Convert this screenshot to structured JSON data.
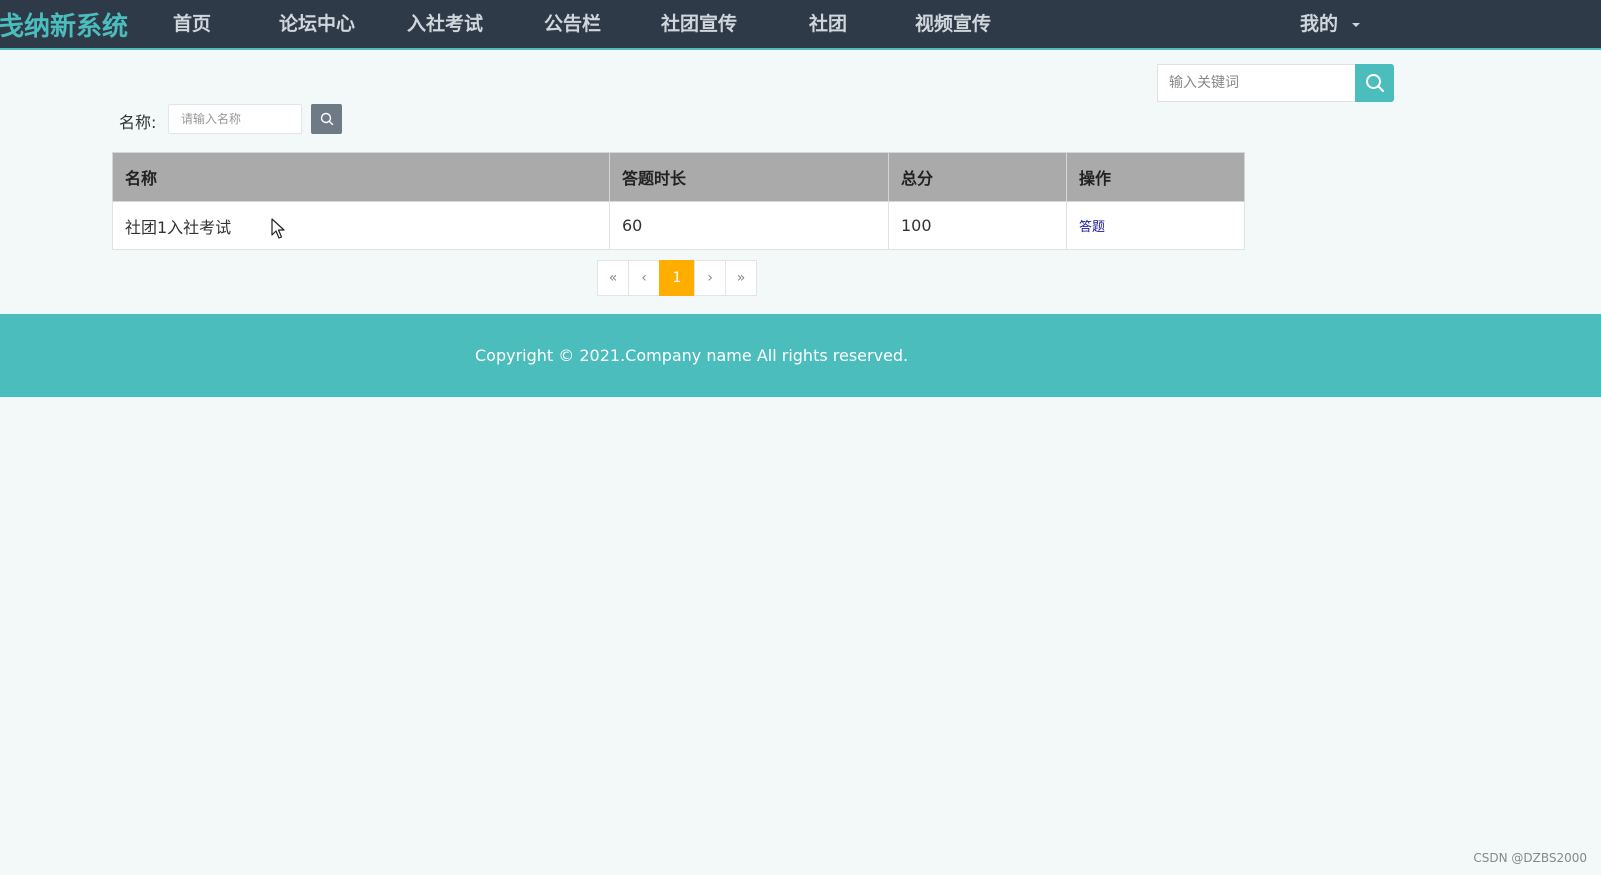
{
  "navbar": {
    "brand": "戋纳新系统",
    "items": [
      "首页",
      "论坛中心",
      "入社考试",
      "公告栏",
      "社团宣传",
      "社团",
      "视频宣传"
    ],
    "me": "我的"
  },
  "search": {
    "placeholder": "输入关键词"
  },
  "filter": {
    "label": "名称:",
    "placeholder": "请输入名称"
  },
  "table": {
    "headers": [
      "名称",
      "答题时长",
      "总分",
      "操作"
    ],
    "rows": [
      {
        "name": "社团1入社考试",
        "duration": "60",
        "total": "100",
        "action": "答题"
      }
    ]
  },
  "pagination": {
    "first": "«",
    "prev": "‹",
    "current": "1",
    "next": "›",
    "last": "»"
  },
  "footer": {
    "text": "Copyright © 2021.Company name All rights reserved."
  },
  "watermark": "CSDN @DZBS2000",
  "colors": {
    "accent": "#4bbdbd",
    "navbar": "#2f3a48",
    "active_page": "#ffae00"
  }
}
